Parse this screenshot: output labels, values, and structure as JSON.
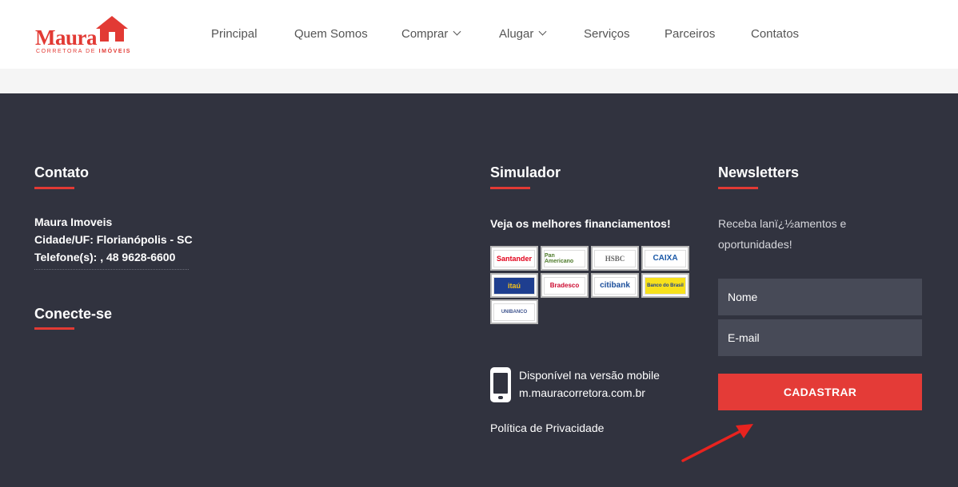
{
  "header": {
    "logo": {
      "name": "Maura",
      "tagline_prefix": "CORRETORA DE ",
      "tagline_bold": "IMÓVEIS"
    },
    "nav": [
      {
        "label": "Principal",
        "has_dropdown": false
      },
      {
        "label": "Quem Somos",
        "has_dropdown": false
      },
      {
        "label": "Comprar",
        "has_dropdown": true
      },
      {
        "label": "Alugar",
        "has_dropdown": true
      },
      {
        "label": "Serviços",
        "has_dropdown": false
      },
      {
        "label": "Parceiros",
        "has_dropdown": false
      },
      {
        "label": "Contatos",
        "has_dropdown": false
      }
    ]
  },
  "footer": {
    "contato": {
      "title": "Contato",
      "lines": [
        "Maura Imoveis",
        "Cidade/UF: Florianópolis - SC",
        "Telefone(s): , 48 9628-6600"
      ]
    },
    "conecte": {
      "title": "Conecte-se"
    },
    "simulador": {
      "title": "Simulador",
      "subtitle": "Veja os melhores financiamentos!",
      "banks": [
        {
          "name": "Santander",
          "icon": "santander-logo"
        },
        {
          "name": "Pan Americano",
          "icon": "panamericano-logo"
        },
        {
          "name": "HSBC",
          "icon": "hsbc-logo"
        },
        {
          "name": "CAIXA",
          "icon": "caixa-logo"
        },
        {
          "name": "itaú",
          "icon": "itau-logo"
        },
        {
          "name": "Bradesco",
          "icon": "bradesco-logo"
        },
        {
          "name": "citibank",
          "icon": "citibank-logo"
        },
        {
          "name": "Banco do Brasil",
          "icon": "bb-logo"
        },
        {
          "name": "UNIBANCO",
          "icon": "unibanco-logo"
        }
      ],
      "mobile_line1": "Disponível na versão mobile",
      "mobile_line2": "m.mauracorretora.com.br",
      "privacy": "Política de Privacidade"
    },
    "newsletter": {
      "title": "Newsletters",
      "text_line1": "Receba lanï¿½amentos e",
      "text_line2": "oportunidades!",
      "name_placeholder": "Nome",
      "email_placeholder": "E-mail",
      "submit_label": "CADASTRAR"
    }
  },
  "colors": {
    "accent": "#e43b37",
    "footer_bg": "#31333f",
    "input_bg": "#474a57",
    "header_bg": "#ffffff"
  }
}
